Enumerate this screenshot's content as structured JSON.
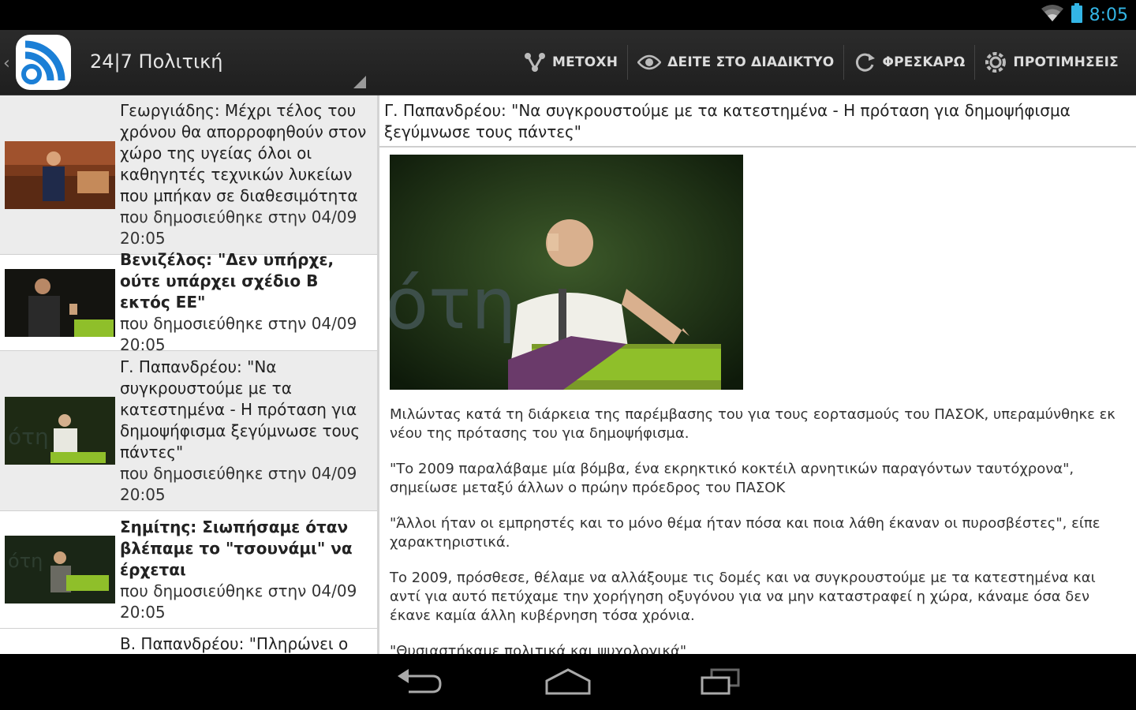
{
  "status_bar": {
    "time": "8:05",
    "icons": [
      "wifi-icon",
      "battery-icon"
    ]
  },
  "action_bar": {
    "title": "24|7 Πολιτική",
    "actions": [
      {
        "label": "ΜΕΤΟΧΗ",
        "icon": "share-icon"
      },
      {
        "label": "ΔΕΙΤΕ ΣΤΟ ΔΙΑΔΙΚΤΥΟ",
        "icon": "eye-icon"
      },
      {
        "label": "ΦΡΕΣΚΑΡΩ",
        "icon": "refresh-icon"
      },
      {
        "label": "ΠΡΟΤΙΜΗΣΕΙΣ",
        "icon": "settings-icon"
      }
    ],
    "colors": {
      "accent": "#33b5e5",
      "logo_blue": "#1b7fd6"
    }
  },
  "list": {
    "items": [
      {
        "title": "Γεωργιάδης: Μέχρι τέλος του χρόνου θα απορροφηθούν στον χώρο της υγείας όλοι οι καθηγητές τεχνικών λυκείων που μπήκαν σε διαθεσιμότητα",
        "meta": "που δημοσιεύθηκε στην 04/09 20:05",
        "bold": false
      },
      {
        "title": "Βενιζέλος: \"Δεν υπήρχε, ούτε υπάρχει σχέδιο Β εκτός ΕΕ\"",
        "meta": "που δημοσιεύθηκε στην 04/09 20:05",
        "bold": true
      },
      {
        "title": "Γ. Παπανδρέου: \"Να συγκρουστούμε με τα κατεστημένα - Η πρόταση για δημοψήφισμα ξεγύμνωσε τους πάντες\"",
        "meta": "που δημοσιεύθηκε στην 04/09 20:05",
        "bold": false
      },
      {
        "title": "Σημίτης: Σιωπήσαμε όταν βλέπαμε το \"τσουνάμι\" να έρχεται",
        "meta": "που δημοσιεύθηκε στην 04/09 20:05",
        "bold": true
      },
      {
        "title": "Β. Παπανδρέου: \"Πληρώνει ο",
        "meta": "",
        "bold": false
      }
    ]
  },
  "article": {
    "title": "Γ. Παπανδρέου: \"Να συγκρουστούμε με τα κατεστημένα - Η πρόταση για δημοψήφισμα ξεγύμνωσε τους πάντες\"",
    "paragraphs": [
      "Μιλώντας κατά τη διάρκεια της παρέμβασης του για τους εορτασμούς του ΠΑΣΟΚ, υπεραμύνθηκε εκ νέου της πρότασης του για δημοψήφισμα.",
      "\"Το 2009 παραλάβαμε μία βόμβα, ένα εκρηκτικό κοκτέιλ αρνητικών παραγόντων ταυτόχρονα\", σημείωσε μεταξύ άλλων ο πρώην πρόεδρος του ΠΑΣΟΚ",
      "\"Άλλοι ήταν οι εμπρηστές και το μόνο θέμα ήταν πόσα και ποια λάθη έκαναν οι πυροσβέστες\", είπε χαρακτηριστικά.",
      "Το 2009, πρόσθεσε, θέλαμε να αλλάξουμε τις δομές και να συγκρουστούμε με τα κατεστημένα και αντί για αυτό πετύχαμε την χορήγηση οξυγόνου για να μην καταστραφεί η χώρα, κάναμε όσα δεν έκανε καμία άλλη κυβέρνηση τόσα χρόνια.",
      "\"Θυσιαστήκαμε πολιτικά και ψυχολογικά\""
    ]
  },
  "nav_bar": {
    "buttons": [
      "back-icon",
      "home-icon",
      "recent-apps-icon"
    ]
  }
}
